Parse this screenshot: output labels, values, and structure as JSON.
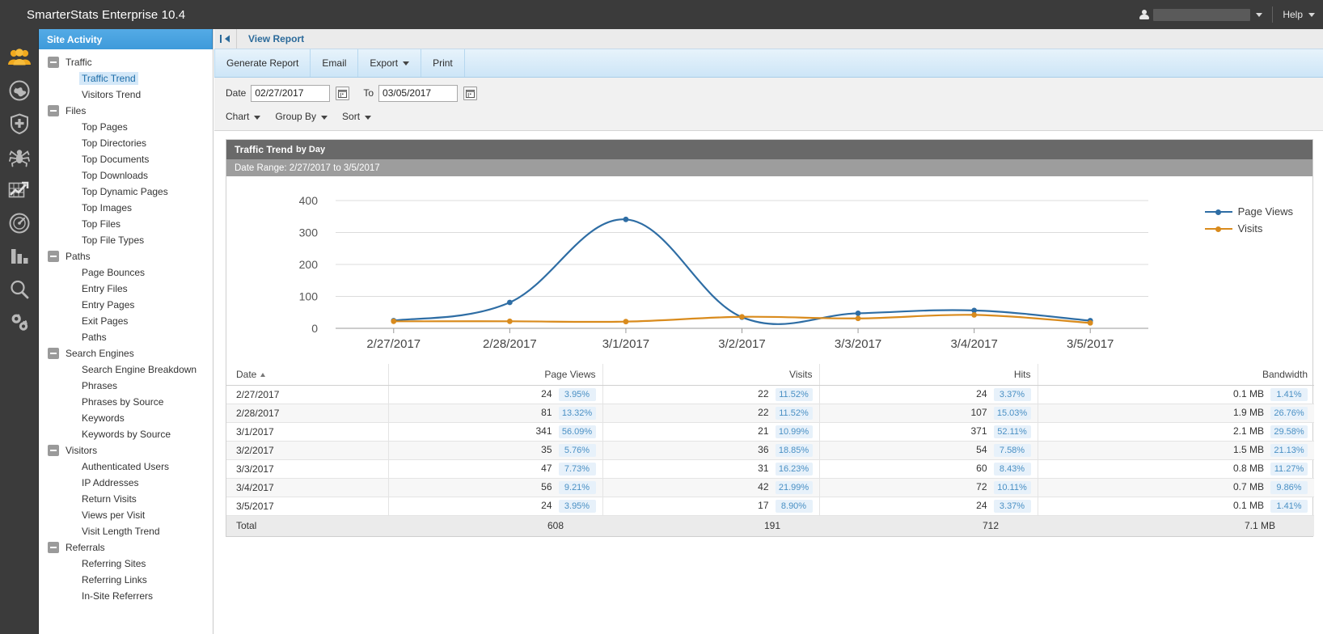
{
  "topbar": {
    "title": "SmarterStats Enterprise 10.4",
    "user_icon": "user-icon",
    "user_name": "",
    "help_label": "Help"
  },
  "rail": {
    "items": [
      {
        "name": "site-activity",
        "icon": "people-icon",
        "active": true
      },
      {
        "name": "server-activity",
        "icon": "globe-icon",
        "active": false
      },
      {
        "name": "security",
        "icon": "shield-plus-icon",
        "active": false
      },
      {
        "name": "bots-spiders",
        "icon": "spider-icon",
        "active": false
      },
      {
        "name": "trends",
        "icon": "chart-trend-icon",
        "active": false
      },
      {
        "name": "performance",
        "icon": "speedometer-icon",
        "active": false
      },
      {
        "name": "reports",
        "icon": "bar-chart-icon",
        "active": false
      },
      {
        "name": "search",
        "icon": "magnifier-icon",
        "active": false
      },
      {
        "name": "settings",
        "icon": "gears-icon",
        "active": false
      }
    ]
  },
  "sidebar": {
    "header": "Site Activity",
    "groups": [
      {
        "label": "Traffic",
        "items": [
          {
            "label": "Traffic Trend",
            "selected": true
          },
          {
            "label": "Visitors Trend",
            "selected": false
          }
        ]
      },
      {
        "label": "Files",
        "items": [
          {
            "label": "Top Pages",
            "selected": false
          },
          {
            "label": "Top Directories",
            "selected": false
          },
          {
            "label": "Top Documents",
            "selected": false
          },
          {
            "label": "Top Downloads",
            "selected": false
          },
          {
            "label": "Top Dynamic Pages",
            "selected": false
          },
          {
            "label": "Top Images",
            "selected": false
          },
          {
            "label": "Top Files",
            "selected": false
          },
          {
            "label": "Top File Types",
            "selected": false
          }
        ]
      },
      {
        "label": "Paths",
        "items": [
          {
            "label": "Page Bounces",
            "selected": false
          },
          {
            "label": "Entry Files",
            "selected": false
          },
          {
            "label": "Entry Pages",
            "selected": false
          },
          {
            "label": "Exit Pages",
            "selected": false
          },
          {
            "label": "Paths",
            "selected": false
          }
        ]
      },
      {
        "label": "Search Engines",
        "items": [
          {
            "label": "Search Engine Breakdown",
            "selected": false
          },
          {
            "label": "Phrases",
            "selected": false
          },
          {
            "label": "Phrases by Source",
            "selected": false
          },
          {
            "label": "Keywords",
            "selected": false
          },
          {
            "label": "Keywords by Source",
            "selected": false
          }
        ]
      },
      {
        "label": "Visitors",
        "items": [
          {
            "label": "Authenticated Users",
            "selected": false
          },
          {
            "label": "IP Addresses",
            "selected": false
          },
          {
            "label": "Return Visits",
            "selected": false
          },
          {
            "label": "Views per Visit",
            "selected": false
          },
          {
            "label": "Visit Length Trend",
            "selected": false
          }
        ]
      },
      {
        "label": "Referrals",
        "items": [
          {
            "label": "Referring Sites",
            "selected": false
          },
          {
            "label": "Referring Links",
            "selected": false
          },
          {
            "label": "In-Site Referrers",
            "selected": false
          }
        ]
      }
    ]
  },
  "tabstrip": {
    "collapse_icon": "collapse-panel-icon",
    "active_tab": "View Report"
  },
  "toolbar": {
    "generate_label": "Generate Report",
    "email_label": "Email",
    "export_label": "Export",
    "print_label": "Print"
  },
  "filters": {
    "date_label": "Date",
    "date_value": "02/27/2017",
    "to_label": "To",
    "to_value": "03/05/2017",
    "calendar_icon": "calendar-icon",
    "chart_menu": "Chart",
    "groupby_menu": "Group By",
    "sort_menu": "Sort"
  },
  "report": {
    "title": "Traffic Trend",
    "title_suffix": "by Day",
    "date_range": "Date Range: 2/27/2017 to 3/5/2017"
  },
  "chart_data": {
    "type": "line",
    "title": "Traffic Trend by Day",
    "xlabel": "",
    "ylabel": "",
    "ylim": [
      0,
      400
    ],
    "yticks": [
      0,
      100,
      200,
      300,
      400
    ],
    "grid": true,
    "legend_position": "right",
    "categories": [
      "2/27/2017",
      "2/28/2017",
      "3/1/2017",
      "3/2/2017",
      "3/3/2017",
      "3/4/2017",
      "3/5/2017"
    ],
    "series": [
      {
        "name": "Page Views",
        "color": "#2e6da4",
        "values": [
          24,
          81,
          341,
          35,
          47,
          56,
          24
        ]
      },
      {
        "name": "Visits",
        "color": "#d98b1d",
        "values": [
          22,
          22,
          21,
          36,
          31,
          42,
          17
        ]
      }
    ]
  },
  "table": {
    "columns": [
      "Date",
      "Page Views",
      "Visits",
      "Hits",
      "Bandwidth"
    ],
    "sort_column": "Date",
    "sort_direction": "asc",
    "rows": [
      {
        "date": "2/27/2017",
        "page_views": "24",
        "page_views_pct": "3.95%",
        "visits": "22",
        "visits_pct": "11.52%",
        "hits": "24",
        "hits_pct": "3.37%",
        "bandwidth": "0.1 MB",
        "bandwidth_pct": "1.41%"
      },
      {
        "date": "2/28/2017",
        "page_views": "81",
        "page_views_pct": "13.32%",
        "visits": "22",
        "visits_pct": "11.52%",
        "hits": "107",
        "hits_pct": "15.03%",
        "bandwidth": "1.9 MB",
        "bandwidth_pct": "26.76%"
      },
      {
        "date": "3/1/2017",
        "page_views": "341",
        "page_views_pct": "56.09%",
        "visits": "21",
        "visits_pct": "10.99%",
        "hits": "371",
        "hits_pct": "52.11%",
        "bandwidth": "2.1 MB",
        "bandwidth_pct": "29.58%"
      },
      {
        "date": "3/2/2017",
        "page_views": "35",
        "page_views_pct": "5.76%",
        "visits": "36",
        "visits_pct": "18.85%",
        "hits": "54",
        "hits_pct": "7.58%",
        "bandwidth": "1.5 MB",
        "bandwidth_pct": "21.13%"
      },
      {
        "date": "3/3/2017",
        "page_views": "47",
        "page_views_pct": "7.73%",
        "visits": "31",
        "visits_pct": "16.23%",
        "hits": "60",
        "hits_pct": "8.43%",
        "bandwidth": "0.8 MB",
        "bandwidth_pct": "11.27%"
      },
      {
        "date": "3/4/2017",
        "page_views": "56",
        "page_views_pct": "9.21%",
        "visits": "42",
        "visits_pct": "21.99%",
        "hits": "72",
        "hits_pct": "10.11%",
        "bandwidth": "0.7 MB",
        "bandwidth_pct": "9.86%"
      },
      {
        "date": "3/5/2017",
        "page_views": "24",
        "page_views_pct": "3.95%",
        "visits": "17",
        "visits_pct": "8.90%",
        "hits": "24",
        "hits_pct": "3.37%",
        "bandwidth": "0.1 MB",
        "bandwidth_pct": "1.41%"
      }
    ],
    "total": {
      "label": "Total",
      "page_views": "608",
      "visits": "191",
      "hits": "712",
      "bandwidth": "7.1 MB"
    }
  },
  "colors": {
    "accent_blue": "#3e9ada",
    "page_views": "#2e6da4",
    "visits": "#d98b1d",
    "topbar": "#3b3b3b",
    "panel_header": "#696969",
    "rail_active": "#f0a91e"
  }
}
